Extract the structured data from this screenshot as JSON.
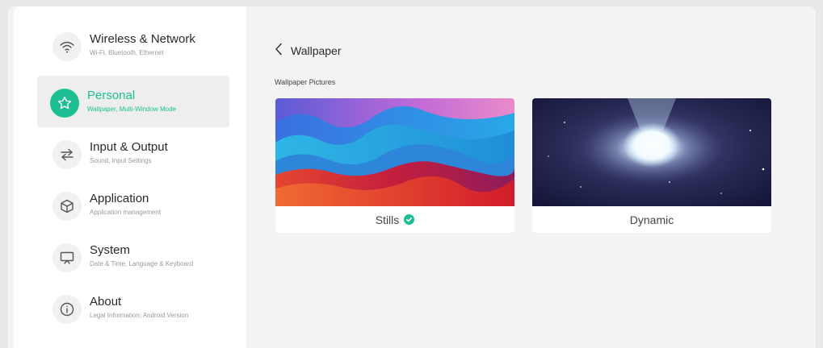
{
  "sidebar": {
    "items": [
      {
        "title": "Wireless & Network",
        "subtitle": "Wi-Fi, Bluetooth, Ethernet",
        "icon": "wifi-icon"
      },
      {
        "title": "Personal",
        "subtitle": "Wallpaper, Multi-Window Mode",
        "icon": "star-icon"
      },
      {
        "title": "Input & Output",
        "subtitle": "Sound, Input Settings",
        "icon": "swap-arrows-icon"
      },
      {
        "title": "Application",
        "subtitle": "Application management",
        "icon": "cube-icon"
      },
      {
        "title": "System",
        "subtitle": "Date & Time, Language & Keyboard",
        "icon": "monitor-icon"
      },
      {
        "title": "About",
        "subtitle": "Legal Information, Android Version",
        "icon": "info-icon"
      }
    ],
    "active_index": 1
  },
  "header": {
    "back_label": "Wallpaper"
  },
  "main": {
    "section_label": "Wallpaper Pictures",
    "cards": [
      {
        "label": "Stills",
        "selected": true
      },
      {
        "label": "Dynamic",
        "selected": false
      }
    ]
  },
  "colors": {
    "accent": "#1bbf93"
  }
}
